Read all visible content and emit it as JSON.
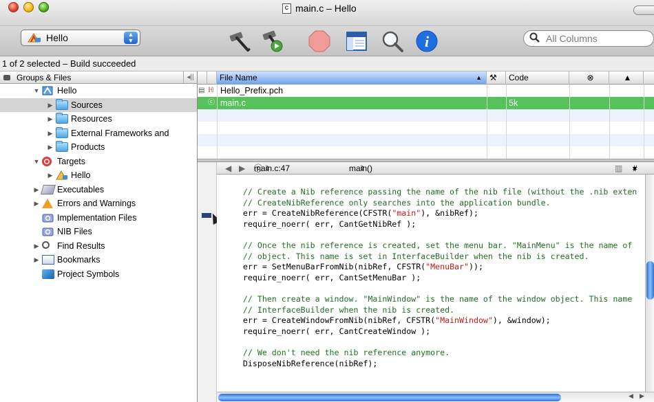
{
  "window": {
    "title": "main.c – Hello",
    "file_badge": "c"
  },
  "toolbar": {
    "target_popup": "Hello",
    "search_placeholder": "All Columns",
    "icons": [
      "build-icon",
      "build-and-go-icon",
      "stop-icon",
      "editor-icon",
      "search-icon",
      "info-icon"
    ],
    "accent": "#1d64c8"
  },
  "status": {
    "text": "1 of 2 selected  –  Build succeeded"
  },
  "groups": {
    "header": "Groups & Files",
    "items": [
      {
        "label": "Hello",
        "icon": "project-icon"
      },
      {
        "label": "Sources",
        "icon": "folder-icon"
      },
      {
        "label": "Resources",
        "icon": "folder-icon"
      },
      {
        "label": "External Frameworks and",
        "icon": "folder-icon"
      },
      {
        "label": "Products",
        "icon": "folder-icon"
      },
      {
        "label": "Targets",
        "icon": "target-icon"
      },
      {
        "label": "Hello",
        "icon": "app-target-icon"
      },
      {
        "label": "Executables",
        "icon": "executable-icon"
      },
      {
        "label": "Errors and Warnings",
        "icon": "warning-icon"
      },
      {
        "label": "Implementation Files",
        "icon": "smart-group-icon"
      },
      {
        "label": "NIB Files",
        "icon": "smart-group-icon"
      },
      {
        "label": "Find Results",
        "icon": "magnifier-icon"
      },
      {
        "label": "Bookmarks",
        "icon": "bookmark-icon"
      },
      {
        "label": "Project Symbols",
        "icon": "cube-icon"
      }
    ]
  },
  "files": {
    "columns": {
      "name": "File Name",
      "code": "Code"
    },
    "rows": [
      {
        "name": "Hello_Prefix.pch",
        "code": ""
      },
      {
        "name": "main.c",
        "code": "5k"
      }
    ],
    "selected_color": "#56c25a"
  },
  "navigator": {
    "file": "main.c:47",
    "function": "main()",
    "hash": "#"
  },
  "code": [
    "    // Create a Nib reference passing the name of the nib file (without the .nib exten",
    "    // CreateNibReference only searches into the application bundle.",
    "    err = CreateNibReference(CFSTR(\"main\"), &nibRef);",
    "    require_noerr( err, CantGetNibRef );",
    "",
    "    // Once the nib reference is created, set the menu bar. \"MainMenu\" is the name of",
    "    // object. This name is set in InterfaceBuilder when the nib is created.",
    "    err = SetMenuBarFromNib(nibRef, CFSTR(\"MenuBar\"));",
    "    require_noerr( err, CantSetMenuBar );",
    "",
    "    // Then create a window. \"MainWindow\" is the name of the window object. This name",
    "    // InterfaceBuilder when the nib is created.",
    "    err = CreateWindowFromNib(nibRef, CFSTR(\"MainWindow\"), &window);",
    "    require_noerr( err, CantCreateWindow );",
    "",
    "    // We don't need the nib reference anymore.",
    "    DisposeNibReference(nibRef);"
  ]
}
